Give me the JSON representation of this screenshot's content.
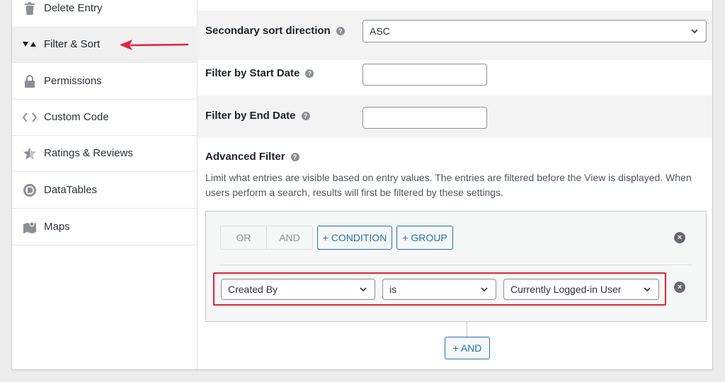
{
  "sidebar": {
    "items": [
      {
        "label": "Delete Entry",
        "icon": "trash-icon"
      },
      {
        "label": "Filter & Sort",
        "icon": "filter-sort-icon",
        "active": true
      },
      {
        "label": "Permissions",
        "icon": "lock-icon"
      },
      {
        "label": "Custom Code",
        "icon": "code-icon"
      },
      {
        "label": "Ratings & Reviews",
        "icon": "star-icon"
      },
      {
        "label": "DataTables",
        "icon": "datatables-icon"
      },
      {
        "label": "Maps",
        "icon": "map-icon"
      }
    ]
  },
  "settings": {
    "secondary_sort": {
      "label": "Secondary sort direction",
      "value": "ASC"
    },
    "start_date": {
      "label": "Filter by Start Date",
      "value": ""
    },
    "end_date": {
      "label": "Filter by End Date",
      "value": ""
    },
    "advanced_filter": {
      "label": "Advanced Filter",
      "description": "Limit what entries are visible based on entry values. The entries are filtered before the View is displayed. When users perform a search, results will first be filtered by these settings.",
      "logic": {
        "or_label": "OR",
        "and_label": "AND"
      },
      "add_condition_label": "+ CONDITION",
      "add_group_label": "+ GROUP",
      "condition": {
        "field": "Created By",
        "operator": "is",
        "value": "Currently Logged-in User"
      },
      "add_and_label": "+ AND"
    }
  },
  "colors": {
    "accent": "#2271b1",
    "highlight": "#e0233b",
    "arrow": "#e0233b"
  }
}
